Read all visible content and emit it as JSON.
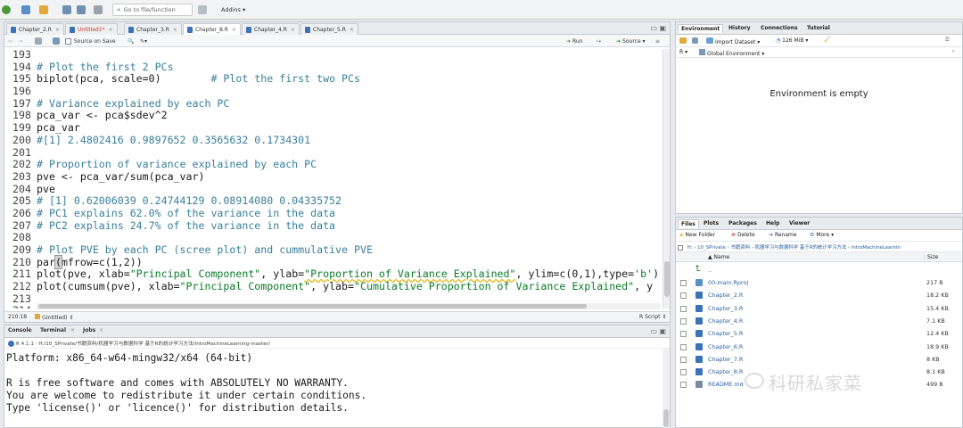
{
  "toolbar": {
    "goto_placeholder": "Go to file/function",
    "addins_label": "Addins"
  },
  "source": {
    "tabs": [
      {
        "label": "Chapter_2.R"
      },
      {
        "label": "Untitled1*"
      },
      {
        "label": "Chapter_3.R"
      },
      {
        "label": "Chapter_8.R"
      },
      {
        "label": "Chapter_4.R"
      },
      {
        "label": "Chapter_5.R"
      }
    ],
    "source_on_save": "Source on Save",
    "run_label": "Run",
    "source_label": "Source",
    "lines": [
      {
        "n": "193",
        "parts": [
          {
            "c": "plain",
            "t": ""
          }
        ]
      },
      {
        "n": "194",
        "parts": [
          {
            "c": "comment",
            "t": "# Plot the first 2 PCs"
          }
        ]
      },
      {
        "n": "195",
        "parts": [
          {
            "c": "plain",
            "t": "biplot(pca, scale=0)        "
          },
          {
            "c": "comment",
            "t": "# Plot the first two PCs"
          }
        ]
      },
      {
        "n": "196",
        "parts": [
          {
            "c": "plain",
            "t": ""
          }
        ]
      },
      {
        "n": "197",
        "parts": [
          {
            "c": "comment",
            "t": "# Variance explained by each PC"
          }
        ]
      },
      {
        "n": "198",
        "parts": [
          {
            "c": "plain",
            "t": "pca_var <- pca$sdev^2"
          }
        ]
      },
      {
        "n": "199",
        "parts": [
          {
            "c": "plain",
            "t": "pca_var"
          }
        ]
      },
      {
        "n": "200",
        "parts": [
          {
            "c": "comment",
            "t": "#[1] 2.4802416 0.9897652 0.3565632 0.1734301"
          }
        ]
      },
      {
        "n": "201",
        "parts": [
          {
            "c": "plain",
            "t": ""
          }
        ]
      },
      {
        "n": "202",
        "parts": [
          {
            "c": "comment",
            "t": "# Proportion of variance explained by each PC"
          }
        ]
      },
      {
        "n": "203",
        "parts": [
          {
            "c": "plain",
            "t": "pve <- pca_var/sum(pca_var)"
          }
        ]
      },
      {
        "n": "204",
        "parts": [
          {
            "c": "plain",
            "t": "pve"
          }
        ]
      },
      {
        "n": "205",
        "parts": [
          {
            "c": "comment",
            "t": "# [1] 0.62006039 0.24744129 0.08914080 0.04335752"
          }
        ]
      },
      {
        "n": "206",
        "parts": [
          {
            "c": "comment",
            "t": "# PC1 explains 62.0% of the variance in the data"
          }
        ]
      },
      {
        "n": "207",
        "parts": [
          {
            "c": "comment",
            "t": "# PC2 explains 24.7% of the variance in the data"
          }
        ]
      },
      {
        "n": "208",
        "parts": [
          {
            "c": "plain",
            "t": ""
          }
        ]
      },
      {
        "n": "209",
        "parts": [
          {
            "c": "comment",
            "t": "# Plot PVE by each PC (scree plot) and cummulative PVE"
          }
        ]
      },
      {
        "n": "210",
        "parts": [
          {
            "c": "plain",
            "t": "par"
          },
          {
            "c": "hl",
            "t": "("
          },
          {
            "c": "plain",
            "t": "mfrow=c(1,2))"
          }
        ]
      },
      {
        "n": "211",
        "parts": [
          {
            "c": "plain",
            "t": "plot(pve, xlab="
          },
          {
            "c": "str",
            "t": "\"Principal Component\""
          },
          {
            "c": "plain",
            "t": ", ylab="
          },
          {
            "c": "strsq",
            "t": "\"Proportion of Variance Explained\""
          },
          {
            "c": "plain",
            "t": ", ylim=c(0,1),type="
          },
          {
            "c": "str",
            "t": "'b'"
          },
          {
            "c": "plain",
            "t": ")"
          }
        ]
      },
      {
        "n": "212",
        "parts": [
          {
            "c": "plain",
            "t": "plot(cumsum(pve), xlab="
          },
          {
            "c": "str",
            "t": "\"Principal Component\""
          },
          {
            "c": "plain",
            "t": ", ylab="
          },
          {
            "c": "str",
            "t": "\"Cumulative Proportion of Variance Explained\""
          },
          {
            "c": "plain",
            "t": ", y"
          }
        ]
      },
      {
        "n": "213",
        "parts": [
          {
            "c": "plain",
            "t": ""
          }
        ]
      },
      {
        "n": "214",
        "parts": [
          {
            "c": "plain",
            "t": ""
          }
        ]
      }
    ],
    "status_pos": "210:18",
    "status_scope": "(Untitled)",
    "status_type": "R Script"
  },
  "console": {
    "tabs": [
      "Console",
      "Terminal",
      "Jobs"
    ],
    "path": "R 4.1.1 · H:/10_SPrivate/书籍资料/机器学习与数据科学 基于R的统计学习方法/IntroMachineLearning-master/",
    "output": [
      "Platform: x86_64-w64-mingw32/x64 (64-bit)",
      "",
      "R is free software and comes with ABSOLUTELY NO WARRANTY.",
      "You are welcome to redistribute it under certain conditions.",
      "Type 'license()' or 'licence()' for distribution details.",
      ""
    ]
  },
  "environment": {
    "tabs": [
      "Environment",
      "History",
      "Connections",
      "Tutorial"
    ],
    "import_dataset": "Import Dataset",
    "memory": "126 MiB",
    "r_label": "R",
    "global_env": "Global Environment",
    "empty_message": "Environment is empty"
  },
  "files": {
    "tabs": [
      "Files",
      "Plots",
      "Packages",
      "Help",
      "Viewer"
    ],
    "new_folder": "New Folder",
    "delete": "Delete",
    "rename": "Rename",
    "more": "More",
    "path": "H: › 10_SPrivate › 书籍资料 › 机器学习与数据科学 基于R的统计学习方法 › IntroMachineLearnin",
    "col_name": "Name",
    "col_size": "Size",
    "up_label": "..",
    "rows": [
      {
        "name": "00-main.Rproj",
        "size": "217 B",
        "kind": "proj"
      },
      {
        "name": "Chapter_2.R",
        "size": "18.2 KB",
        "kind": "r"
      },
      {
        "name": "Chapter_3.R",
        "size": "15.4 KB",
        "kind": "r"
      },
      {
        "name": "Chapter_4.R",
        "size": "7.1 KB",
        "kind": "r"
      },
      {
        "name": "Chapter_5.R",
        "size": "12.4 KB",
        "kind": "r"
      },
      {
        "name": "Chapter_6.R",
        "size": "18.9 KB",
        "kind": "r"
      },
      {
        "name": "Chapter_7.R",
        "size": "8 KB",
        "kind": "r"
      },
      {
        "name": "Chapter_8.R",
        "size": "8.1 KB",
        "kind": "r"
      },
      {
        "name": "README.md",
        "size": "499 B",
        "kind": "md"
      }
    ]
  },
  "watermark": {
    "text": "科研私家菜"
  },
  "colors": {
    "accent": "#3b72b8",
    "comment": "#3a7f9a",
    "string": "#0a7a2a"
  }
}
